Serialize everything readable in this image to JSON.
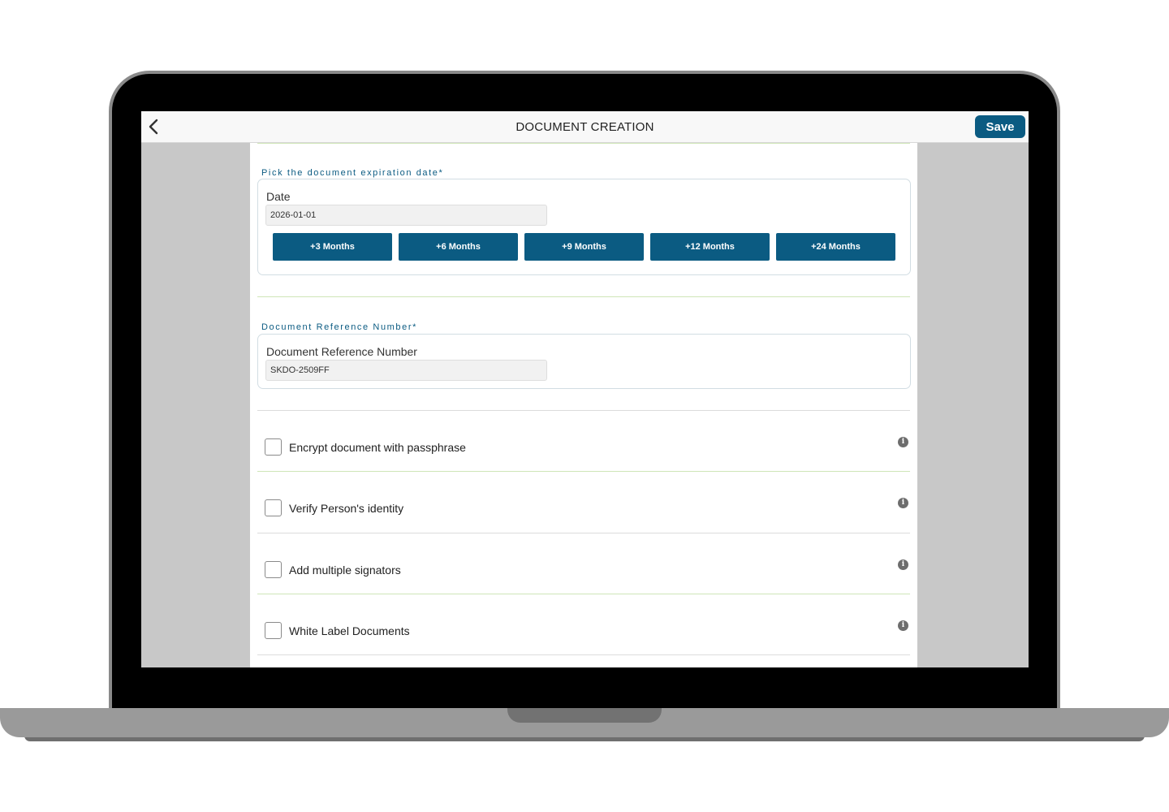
{
  "header": {
    "title": "DOCUMENT CREATION",
    "save_label": "Save"
  },
  "expiration": {
    "section_label": "Pick the document expiration date*",
    "field_label": "Date",
    "value": "2026-01-01",
    "quick_buttons": [
      "+3 Months",
      "+6 Months",
      "+9 Months",
      "+12 Months",
      "+24 Months"
    ]
  },
  "reference": {
    "section_label": "Document Reference Number*",
    "field_label": "Document Reference Number",
    "value": "SKDO-2509FF"
  },
  "options": [
    {
      "label": "Encrypt document with passphrase",
      "checked": false
    },
    {
      "label": "Verify Person's identity",
      "checked": false
    },
    {
      "label": "Add multiple signators",
      "checked": false
    },
    {
      "label": "White Label Documents",
      "checked": false
    }
  ],
  "colors": {
    "accent": "#0b5b82",
    "divider_green": "#cfe6b8",
    "side_gray": "#c8c8c8"
  },
  "icons": {
    "back": "chevron-left-icon",
    "info": "info-icon"
  }
}
